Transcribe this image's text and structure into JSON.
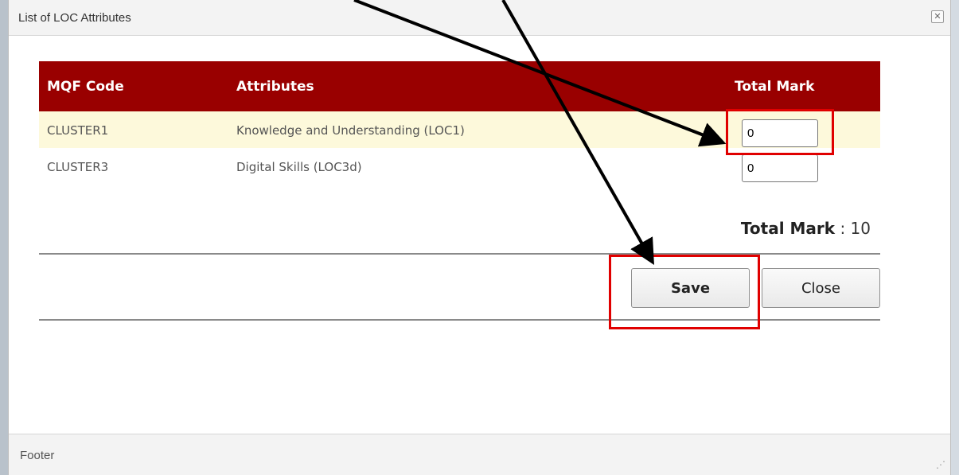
{
  "dialog": {
    "title": "List of LOC Attributes",
    "close_icon": "close-icon",
    "footer": "Footer"
  },
  "table": {
    "headers": [
      "MQF Code",
      "Attributes",
      "Total Mark"
    ],
    "rows": [
      {
        "code": "CLUSTER1",
        "attribute": "Knowledge and Understanding (LOC1)",
        "mark": "0"
      },
      {
        "code": "CLUSTER3",
        "attribute": "Digital Skills (LOC3d)",
        "mark": "0"
      }
    ]
  },
  "summary": {
    "label": "Total Mark",
    "separator": " : ",
    "value": "10"
  },
  "buttons": {
    "save": "Save",
    "close": "Close"
  },
  "colors": {
    "header_bg": "#990000",
    "highlight_row": "#fdf9db",
    "annotation_red": "#e00000"
  }
}
